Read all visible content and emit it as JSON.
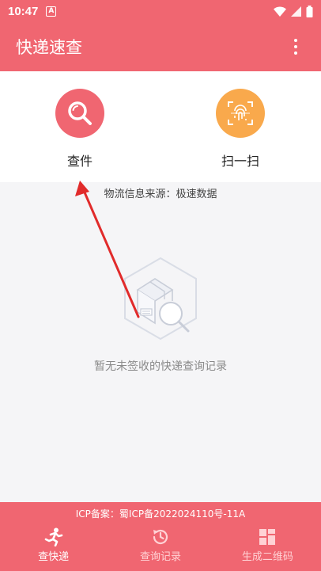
{
  "status": {
    "time": "10:47",
    "notif": "A"
  },
  "app": {
    "title": "快递速查"
  },
  "actions": {
    "query_label": "查件",
    "scan_label": "扫一扫"
  },
  "source_text": "物流信息来源：极速数据",
  "empty_text": "暂无未签收的快递查询记录",
  "footer": {
    "icp": "ICP备案：蜀ICP备2022024110号-11A",
    "tabs": [
      {
        "label": "查快递"
      },
      {
        "label": "查询记录"
      },
      {
        "label": "生成二维码"
      }
    ]
  },
  "colors": {
    "primary": "#f06671",
    "scan_orange": "#f9a94c",
    "query_red": "#f06671"
  }
}
